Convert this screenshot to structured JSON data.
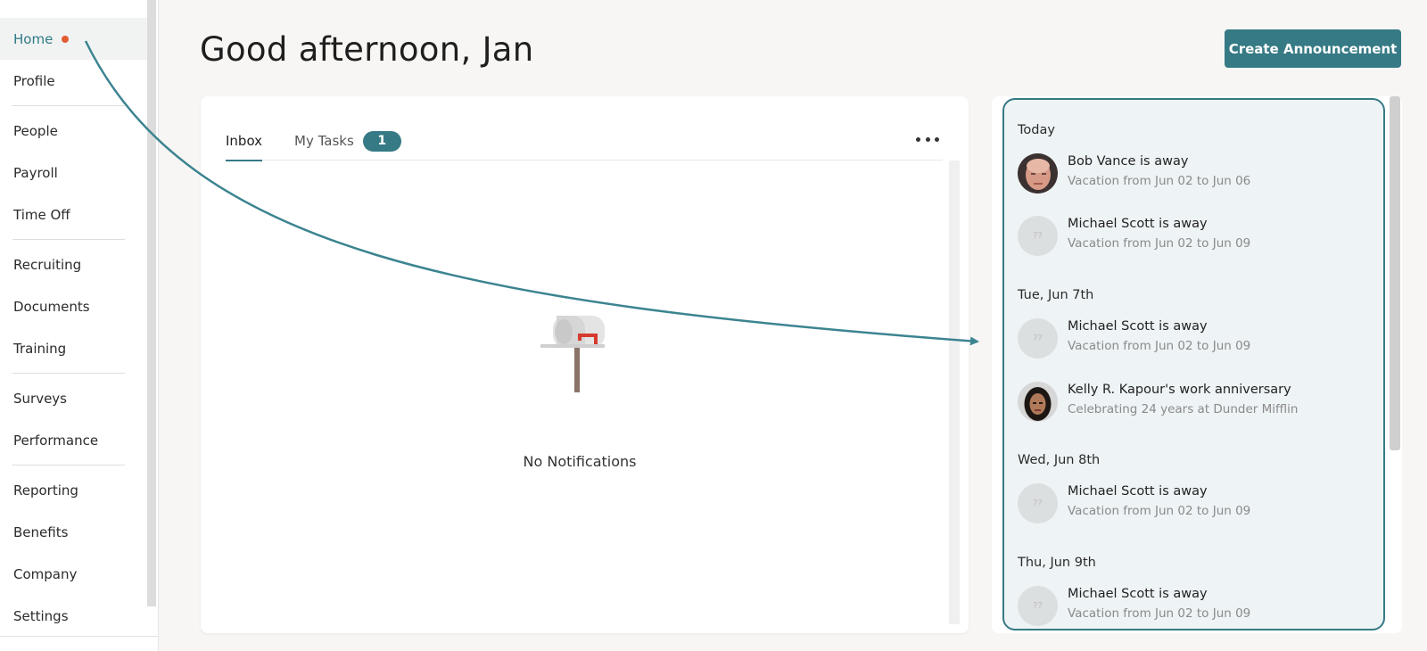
{
  "sidebar": {
    "items": [
      {
        "label": "Home",
        "active": true,
        "notification": true
      },
      {
        "label": "Profile"
      },
      {
        "label": "People"
      },
      {
        "label": "Payroll"
      },
      {
        "label": "Time Off"
      },
      {
        "label": "Recruiting"
      },
      {
        "label": "Documents"
      },
      {
        "label": "Training"
      },
      {
        "label": "Surveys"
      },
      {
        "label": "Performance"
      },
      {
        "label": "Reporting"
      },
      {
        "label": "Benefits"
      },
      {
        "label": "Company"
      },
      {
        "label": "Settings"
      }
    ]
  },
  "header": {
    "greeting": "Good afternoon, Jan",
    "create_label": "Create Announcement"
  },
  "inbox": {
    "tabs": [
      {
        "label": "Inbox",
        "active": true
      },
      {
        "label": "My Tasks",
        "count": "1"
      }
    ],
    "empty_text": "No Notifications",
    "empty_icon": "mailbox-icon"
  },
  "feed": {
    "groups": [
      {
        "date": "Today",
        "entries": [
          {
            "title": "Bob Vance is away",
            "subtitle": "Vacation from Jun 02 to Jun 06",
            "avatar": "photo"
          },
          {
            "title": "Michael Scott is away",
            "subtitle": "Vacation from Jun 02 to Jun 09",
            "avatar": "??"
          }
        ]
      },
      {
        "date": "Tue, Jun 7th",
        "entries": [
          {
            "title": "Michael Scott is away",
            "subtitle": "Vacation from Jun 02 to Jun 09",
            "avatar": "??"
          },
          {
            "title": "Kelly R. Kapour's work anniversary",
            "subtitle": "Celebrating 24 years at Dunder Mifflin",
            "avatar": "photo"
          }
        ]
      },
      {
        "date": "Wed, Jun 8th",
        "entries": [
          {
            "title": "Michael Scott is away",
            "subtitle": "Vacation from Jun 02 to Jun 09",
            "avatar": "??"
          }
        ]
      },
      {
        "date": "Thu, Jun 9th",
        "entries": [
          {
            "title": "Michael Scott is away",
            "subtitle": "Vacation from Jun 02 to Jun 09",
            "avatar": "??"
          }
        ]
      }
    ]
  },
  "colors": {
    "accent": "#367a85",
    "notification_dot": "#e25c33",
    "panel_bg": "#eef3f5"
  }
}
